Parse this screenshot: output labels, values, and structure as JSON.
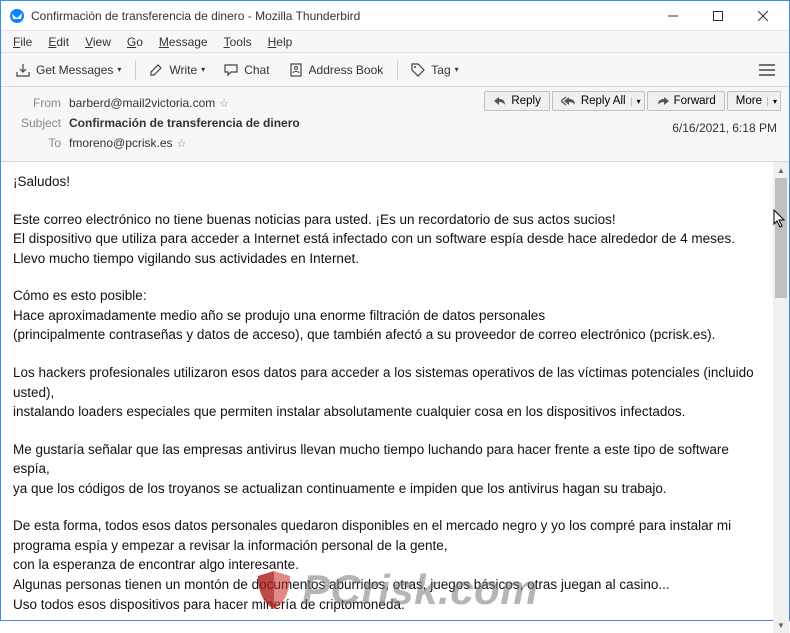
{
  "window": {
    "title": "Confirmación de transferencia de dinero - Mozilla Thunderbird"
  },
  "menu": {
    "file": "File",
    "edit": "Edit",
    "view": "View",
    "go": "Go",
    "message": "Message",
    "tools": "Tools",
    "help": "Help"
  },
  "toolbar": {
    "get_messages": "Get Messages",
    "write": "Write",
    "chat": "Chat",
    "address_book": "Address Book",
    "tag": "Tag"
  },
  "actions": {
    "reply": "Reply",
    "reply_all": "Reply All",
    "forward": "Forward",
    "more": "More"
  },
  "headers": {
    "from_label": "From",
    "from_value": "barberd@mail2victoria.com",
    "subject_label": "Subject",
    "subject_value": "Confirmación de transferencia de dinero",
    "to_label": "To",
    "to_value": "fmoreno@pcrisk.es",
    "date": "6/16/2021, 6:18 PM"
  },
  "body": {
    "p1": "¡Saludos!",
    "p2": "Este correo electrónico no tiene buenas noticias para usted. ¡Es un recordatorio de sus actos sucios!\nEl dispositivo que utiliza para acceder a Internet está infectado con un software espía desde hace alrededor de 4 meses.\nLlevo mucho tiempo vigilando sus actividades en Internet.",
    "p3": "Cómo es esto posible:\nHace aproximadamente medio año se produjo una enorme filtración de datos personales\n(principalmente contraseñas y datos de acceso), que también afectó a su proveedor de correo electrónico (pcrisk.es).",
    "p4": "Los hackers profesionales utilizaron esos datos para acceder a los sistemas operativos de las víctimas potenciales (incluido usted),\ninstalando loaders especiales que permiten instalar absolutamente cualquier cosa en los dispositivos infectados.",
    "p5": "Me gustaría señalar que las empresas antivirus llevan mucho tiempo luchando para hacer frente a este tipo de software espía,\nya que los códigos de los troyanos se actualizan continuamente e impiden que los antivirus hagan su trabajo.",
    "p6": "De esta forma, todos esos datos personales quedaron disponibles en el mercado negro y yo los compré para instalar mi programa espía y empezar a revisar la información personal de la gente,\ncon la esperanza de encontrar algo interesante.\nAlgunas personas tienen un montón de documentos aburridos, otras, juegos básicos, otras juegan al casino...\nUso todos esos dispositivos para hacer minería de criptomoneda."
  },
  "watermark": {
    "text": "PCrisk.com"
  }
}
